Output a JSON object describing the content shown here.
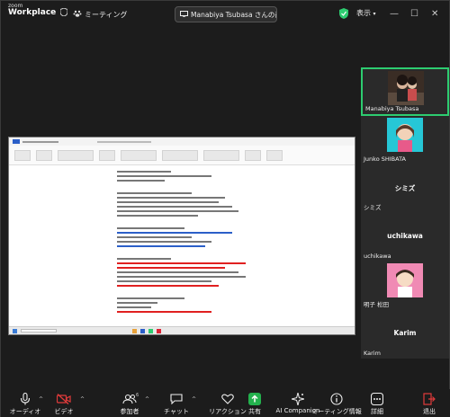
{
  "app": {
    "brand_top": "zoom",
    "brand_bottom": "Workplace"
  },
  "topbar": {
    "meeting_label": "ミーティング",
    "share_pill": "Manabiya Tsubasa さんの画面",
    "view_label": "表示"
  },
  "participants": [
    {
      "name": "Manabiya Tsubasa",
      "type": "photo",
      "active": true
    },
    {
      "name": "Junko SHIBATA",
      "type": "avatar"
    },
    {
      "name": "シミズ",
      "center": "シミズ",
      "type": "text"
    },
    {
      "name": "uchikawa",
      "center": "uchikawa",
      "type": "text"
    },
    {
      "name": "明子 松田",
      "type": "avatar"
    },
    {
      "name": "Karim",
      "center": "Karim",
      "type": "text"
    }
  ],
  "toolbar": {
    "audio": "オーディオ",
    "video": "ビデオ",
    "participants": "参加者",
    "participants_count": "6",
    "chat": "チャット",
    "reactions": "リアクション",
    "share": "共有",
    "ai_companion": "AI Companion",
    "meeting_info": "ミーティング情報",
    "details": "詳細",
    "leave": "退出"
  },
  "colors": {
    "active_border": "#2dcc70",
    "share_green": "#23b14d",
    "leave_red": "#e23b3b",
    "video_red": "#e23b3b"
  }
}
